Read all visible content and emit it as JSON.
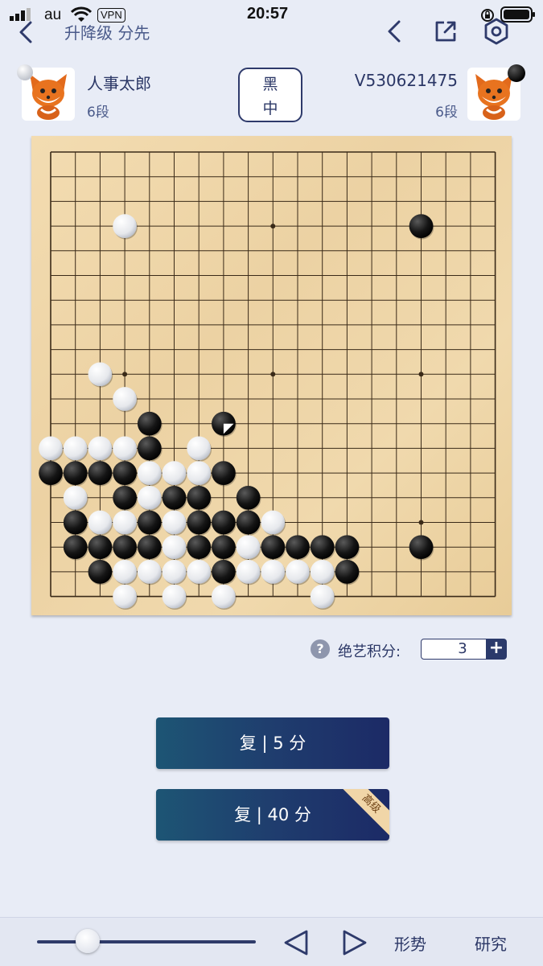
{
  "status_bar": {
    "carrier": "au",
    "vpn": "VPN",
    "time": "20:57"
  },
  "nav": {
    "title": "升降级 分先",
    "back_icon": "chevron-left-icon",
    "prev_icon": "chevron-left-icon",
    "share_icon": "share-icon",
    "settings_icon": "hexagon-gear-icon"
  },
  "players": {
    "left": {
      "name": "人事太郎",
      "rank": "6段",
      "stone": "white"
    },
    "right": {
      "name": "V530621475",
      "rank": "6段",
      "stone": "black"
    }
  },
  "result": {
    "line1": "黑",
    "line2": "中"
  },
  "board": {
    "size": 19,
    "last_move": [
      7,
      11
    ],
    "stones": [
      {
        "c": "W",
        "x": 3,
        "y": 3
      },
      {
        "c": "B",
        "x": 15,
        "y": 3
      },
      {
        "c": "W",
        "x": 2,
        "y": 9
      },
      {
        "c": "W",
        "x": 3,
        "y": 10
      },
      {
        "c": "B",
        "x": 4,
        "y": 11
      },
      {
        "c": "B",
        "x": 7,
        "y": 11
      },
      {
        "c": "W",
        "x": 0,
        "y": 12
      },
      {
        "c": "W",
        "x": 1,
        "y": 12
      },
      {
        "c": "W",
        "x": 2,
        "y": 12
      },
      {
        "c": "W",
        "x": 3,
        "y": 12
      },
      {
        "c": "B",
        "x": 4,
        "y": 12
      },
      {
        "c": "W",
        "x": 6,
        "y": 12
      },
      {
        "c": "B",
        "x": 0,
        "y": 13
      },
      {
        "c": "B",
        "x": 1,
        "y": 13
      },
      {
        "c": "B",
        "x": 2,
        "y": 13
      },
      {
        "c": "B",
        "x": 3,
        "y": 13
      },
      {
        "c": "W",
        "x": 4,
        "y": 13
      },
      {
        "c": "W",
        "x": 5,
        "y": 13
      },
      {
        "c": "W",
        "x": 6,
        "y": 13
      },
      {
        "c": "B",
        "x": 7,
        "y": 13
      },
      {
        "c": "W",
        "x": 1,
        "y": 14
      },
      {
        "c": "B",
        "x": 3,
        "y": 14
      },
      {
        "c": "W",
        "x": 4,
        "y": 14
      },
      {
        "c": "B",
        "x": 5,
        "y": 14
      },
      {
        "c": "B",
        "x": 6,
        "y": 14
      },
      {
        "c": "B",
        "x": 8,
        "y": 14
      },
      {
        "c": "B",
        "x": 1,
        "y": 15
      },
      {
        "c": "W",
        "x": 2,
        "y": 15
      },
      {
        "c": "W",
        "x": 3,
        "y": 15
      },
      {
        "c": "B",
        "x": 4,
        "y": 15
      },
      {
        "c": "W",
        "x": 5,
        "y": 15
      },
      {
        "c": "B",
        "x": 6,
        "y": 15
      },
      {
        "c": "B",
        "x": 7,
        "y": 15
      },
      {
        "c": "B",
        "x": 8,
        "y": 15
      },
      {
        "c": "W",
        "x": 9,
        "y": 15
      },
      {
        "c": "B",
        "x": 1,
        "y": 16
      },
      {
        "c": "B",
        "x": 2,
        "y": 16
      },
      {
        "c": "B",
        "x": 3,
        "y": 16
      },
      {
        "c": "B",
        "x": 4,
        "y": 16
      },
      {
        "c": "W",
        "x": 5,
        "y": 16
      },
      {
        "c": "B",
        "x": 6,
        "y": 16
      },
      {
        "c": "B",
        "x": 7,
        "y": 16
      },
      {
        "c": "W",
        "x": 8,
        "y": 16
      },
      {
        "c": "B",
        "x": 9,
        "y": 16
      },
      {
        "c": "B",
        "x": 10,
        "y": 16
      },
      {
        "c": "B",
        "x": 11,
        "y": 16
      },
      {
        "c": "B",
        "x": 12,
        "y": 16
      },
      {
        "c": "B",
        "x": 15,
        "y": 16
      },
      {
        "c": "B",
        "x": 2,
        "y": 17
      },
      {
        "c": "W",
        "x": 3,
        "y": 17
      },
      {
        "c": "W",
        "x": 4,
        "y": 17
      },
      {
        "c": "W",
        "x": 5,
        "y": 17
      },
      {
        "c": "W",
        "x": 6,
        "y": 17
      },
      {
        "c": "B",
        "x": 7,
        "y": 17
      },
      {
        "c": "W",
        "x": 8,
        "y": 17
      },
      {
        "c": "W",
        "x": 9,
        "y": 17
      },
      {
        "c": "W",
        "x": 10,
        "y": 17
      },
      {
        "c": "W",
        "x": 11,
        "y": 17
      },
      {
        "c": "B",
        "x": 12,
        "y": 17
      },
      {
        "c": "W",
        "x": 3,
        "y": 18
      },
      {
        "c": "W",
        "x": 5,
        "y": 18
      },
      {
        "c": "W",
        "x": 7,
        "y": 18
      },
      {
        "c": "W",
        "x": 11,
        "y": 18
      }
    ]
  },
  "score": {
    "help_icon": "question-circle-icon",
    "label": "绝艺积分:",
    "value": "3",
    "plus": "+"
  },
  "buttons": {
    "review_basic": "复 | 5 分",
    "review_premium": "复 | 40 分",
    "premium_badge": "高级"
  },
  "bottom": {
    "slider_value": 0.23,
    "prev_icon": "triangle-left-icon",
    "next_icon": "triangle-right-icon",
    "situation": "形势",
    "research": "研究"
  }
}
